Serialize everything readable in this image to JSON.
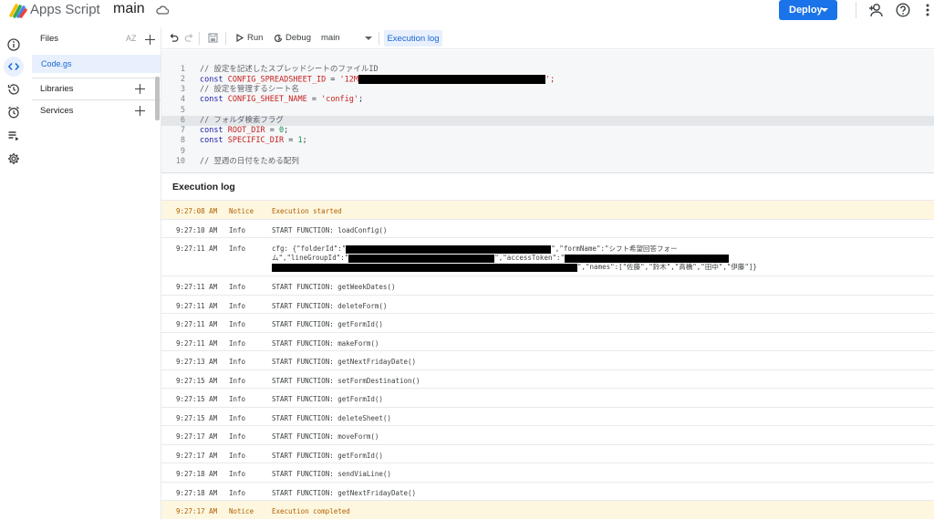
{
  "app": {
    "name": "Apps Script",
    "project": "main",
    "deploy_label": "Deploy",
    "brand_color": "#1a73e8"
  },
  "rail": {
    "items": [
      {
        "icon": "info-icon"
      },
      {
        "icon": "code-brackets-icon",
        "active": true
      },
      {
        "icon": "history-icon"
      },
      {
        "icon": "alarm-clock-icon"
      },
      {
        "icon": "executions-list-icon"
      },
      {
        "icon": "gear-icon"
      }
    ]
  },
  "files": {
    "header": "Files",
    "sort_label": "AZ",
    "items": [
      "Code.gs"
    ],
    "sections": [
      "Libraries",
      "Services"
    ]
  },
  "toolbar": {
    "run": "Run",
    "debug": "Debug",
    "function": "main",
    "execution_log": "Execution log"
  },
  "editor": {
    "lines": [
      {
        "n": "1",
        "parts": [
          {
            "t": "// 設定を記述したスプレッドシートのファイルID",
            "c": "comment"
          }
        ]
      },
      {
        "n": "2",
        "parts": [
          {
            "t": "const ",
            "c": "kw"
          },
          {
            "t": "CONFIG_SPREADSHEET_ID",
            "c": "var"
          },
          {
            "t": " = ",
            "c": "plain"
          },
          {
            "t": "'12M",
            "c": "str"
          },
          {
            "redact": true
          },
          {
            "t": "';",
            "c": "str"
          }
        ]
      },
      {
        "n": "3",
        "parts": [
          {
            "t": "// 設定を管理するシート名",
            "c": "comment"
          }
        ]
      },
      {
        "n": "4",
        "parts": [
          {
            "t": "const ",
            "c": "kw"
          },
          {
            "t": "CONFIG_SHEET_NAME",
            "c": "var"
          },
          {
            "t": " = ",
            "c": "plain"
          },
          {
            "t": "'config'",
            "c": "str"
          },
          {
            "t": ";",
            "c": "plain"
          }
        ]
      },
      {
        "n": "5",
        "parts": []
      },
      {
        "n": "6",
        "sel": true,
        "parts": [
          {
            "t": "// フォルダ検索フラグ",
            "c": "comment"
          }
        ]
      },
      {
        "n": "7",
        "parts": [
          {
            "t": "const ",
            "c": "kw"
          },
          {
            "t": "ROOT_DIR",
            "c": "var"
          },
          {
            "t": " = ",
            "c": "plain"
          },
          {
            "t": "0",
            "c": "num"
          },
          {
            "t": ";",
            "c": "plain"
          }
        ]
      },
      {
        "n": "8",
        "parts": [
          {
            "t": "const ",
            "c": "kw"
          },
          {
            "t": "SPECIFIC_DIR",
            "c": "var"
          },
          {
            "t": " = ",
            "c": "plain"
          },
          {
            "t": "1",
            "c": "num"
          },
          {
            "t": ";",
            "c": "plain"
          }
        ]
      },
      {
        "n": "9",
        "parts": []
      },
      {
        "n": "10",
        "parts": [
          {
            "t": "// 翌週の日付をためる配列",
            "c": "comment"
          }
        ]
      }
    ]
  },
  "log": {
    "title": "Execution log",
    "rows": [
      {
        "time": "9:27:08 AM",
        "level": "Notice",
        "msg": "Execution started",
        "notice": true
      },
      {
        "time": "9:27:10 AM",
        "level": "Info",
        "msg": "START FUNCTION: loadConfig()"
      },
      {
        "time": "9:27:11 AM",
        "level": "Info",
        "cfg": true,
        "cfg1a": "cfg: {\"folderId\":\"",
        "cfg1b": "\",\"formName\":\"シフト希望回答フォー",
        "cfg2a": "ム\",\"lineGroupId\":\"",
        "cfg2b": "\",\"accessToken\":\"",
        "cfg3b": "\",\"names\":[\"佐藤\",\"鈴木\",\"高橋\",\"田中\",\"伊藤\"]}"
      },
      {
        "time": "9:27:11 AM",
        "level": "Info",
        "msg": "START FUNCTION: getWeekDates()"
      },
      {
        "time": "9:27:11 AM",
        "level": "Info",
        "msg": "START FUNCTION: deleteForm()"
      },
      {
        "time": "9:27:11 AM",
        "level": "Info",
        "msg": "START FUNCTION: getFormId()"
      },
      {
        "time": "9:27:11 AM",
        "level": "Info",
        "msg": "START FUNCTION: makeForm()"
      },
      {
        "time": "9:27:13 AM",
        "level": "Info",
        "msg": "START FUNCTION: getNextFridayDate()"
      },
      {
        "time": "9:27:15 AM",
        "level": "Info",
        "msg": "START FUNCTION: setFormDestination()"
      },
      {
        "time": "9:27:15 AM",
        "level": "Info",
        "msg": "START FUNCTION: getFormId()"
      },
      {
        "time": "9:27:15 AM",
        "level": "Info",
        "msg": "START FUNCTION: deleteSheet()"
      },
      {
        "time": "9:27:17 AM",
        "level": "Info",
        "msg": "START FUNCTION: moveForm()"
      },
      {
        "time": "9:27:17 AM",
        "level": "Info",
        "msg": "START FUNCTION: getFormId()"
      },
      {
        "time": "9:27:18 AM",
        "level": "Info",
        "msg": "START FUNCTION: sendViaLine()"
      },
      {
        "time": "9:27:18 AM",
        "level": "Info",
        "msg": "START FUNCTION: getNextFridayDate()"
      },
      {
        "time": "9:27:17 AM",
        "level": "Notice",
        "msg": "Execution completed",
        "notice": true
      }
    ]
  }
}
